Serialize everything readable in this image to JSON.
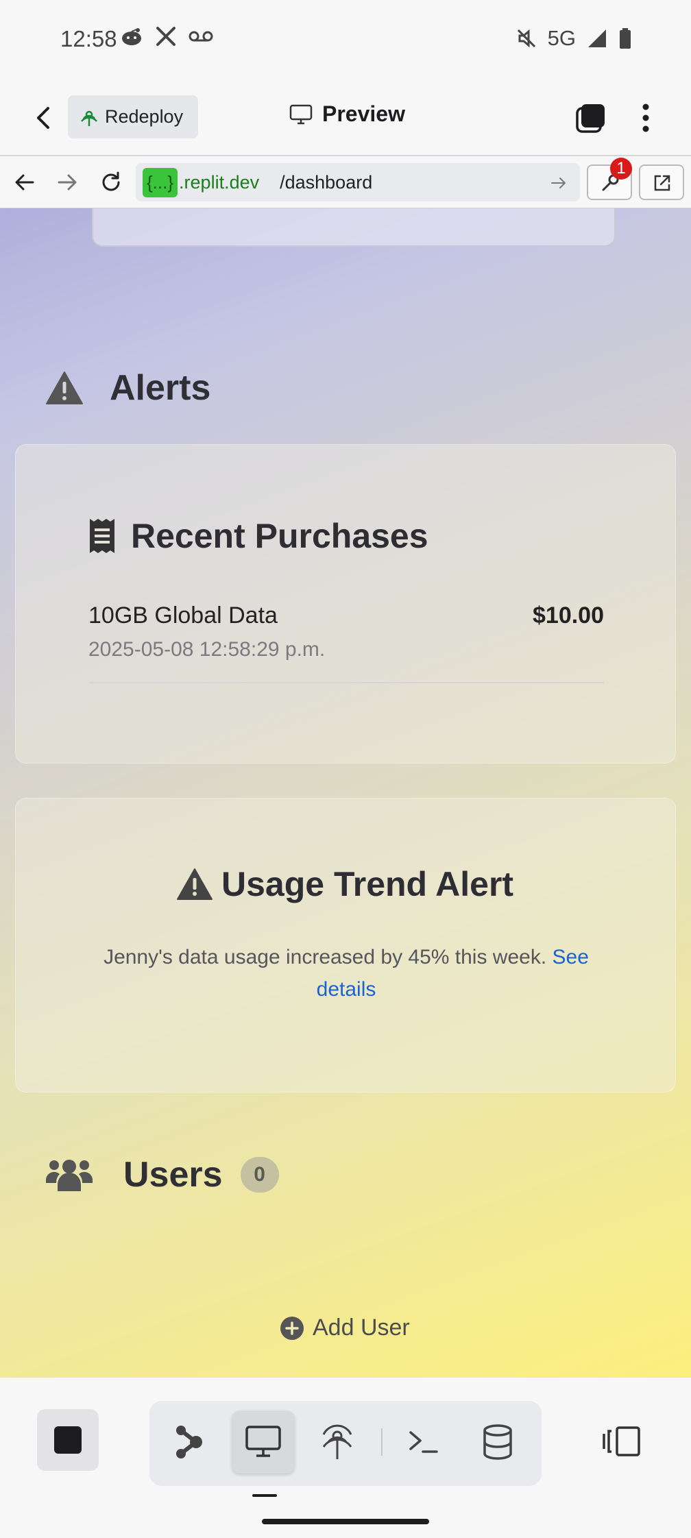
{
  "status_bar": {
    "time": "12:58",
    "network": "5G",
    "left_icons": [
      "reddit-icon",
      "x-icon",
      "voicemail-icon"
    ],
    "right_icons": [
      "mute-icon",
      "signal-icon",
      "battery-icon"
    ]
  },
  "header": {
    "redeploy_label": "Redeploy",
    "title": "Preview"
  },
  "url_bar": {
    "chip": "{...}",
    "domain": ".replit.dev",
    "path": "/dashboard",
    "devtools_badge": "1"
  },
  "alerts_section": {
    "title": "Alerts"
  },
  "purchases": {
    "title": "Recent Purchases",
    "items": [
      {
        "name": "10GB Global Data",
        "price": "$10.00",
        "date": "2025-05-08 12:58:29 p.m."
      }
    ]
  },
  "usage_alert": {
    "title": "Usage Trend Alert",
    "message": "Jenny's data usage increased by 45% this week.",
    "link_part1": "See",
    "link_part2": "details"
  },
  "users_section": {
    "title": "Users",
    "count": "0",
    "add_label": "Add User"
  },
  "colors": {
    "accent_green": "#3cc33c",
    "link_blue": "#1a63d1",
    "badge_red": "#d91a1a",
    "gradient_start": "#aeb0dc",
    "gradient_end": "#fcef7e"
  }
}
